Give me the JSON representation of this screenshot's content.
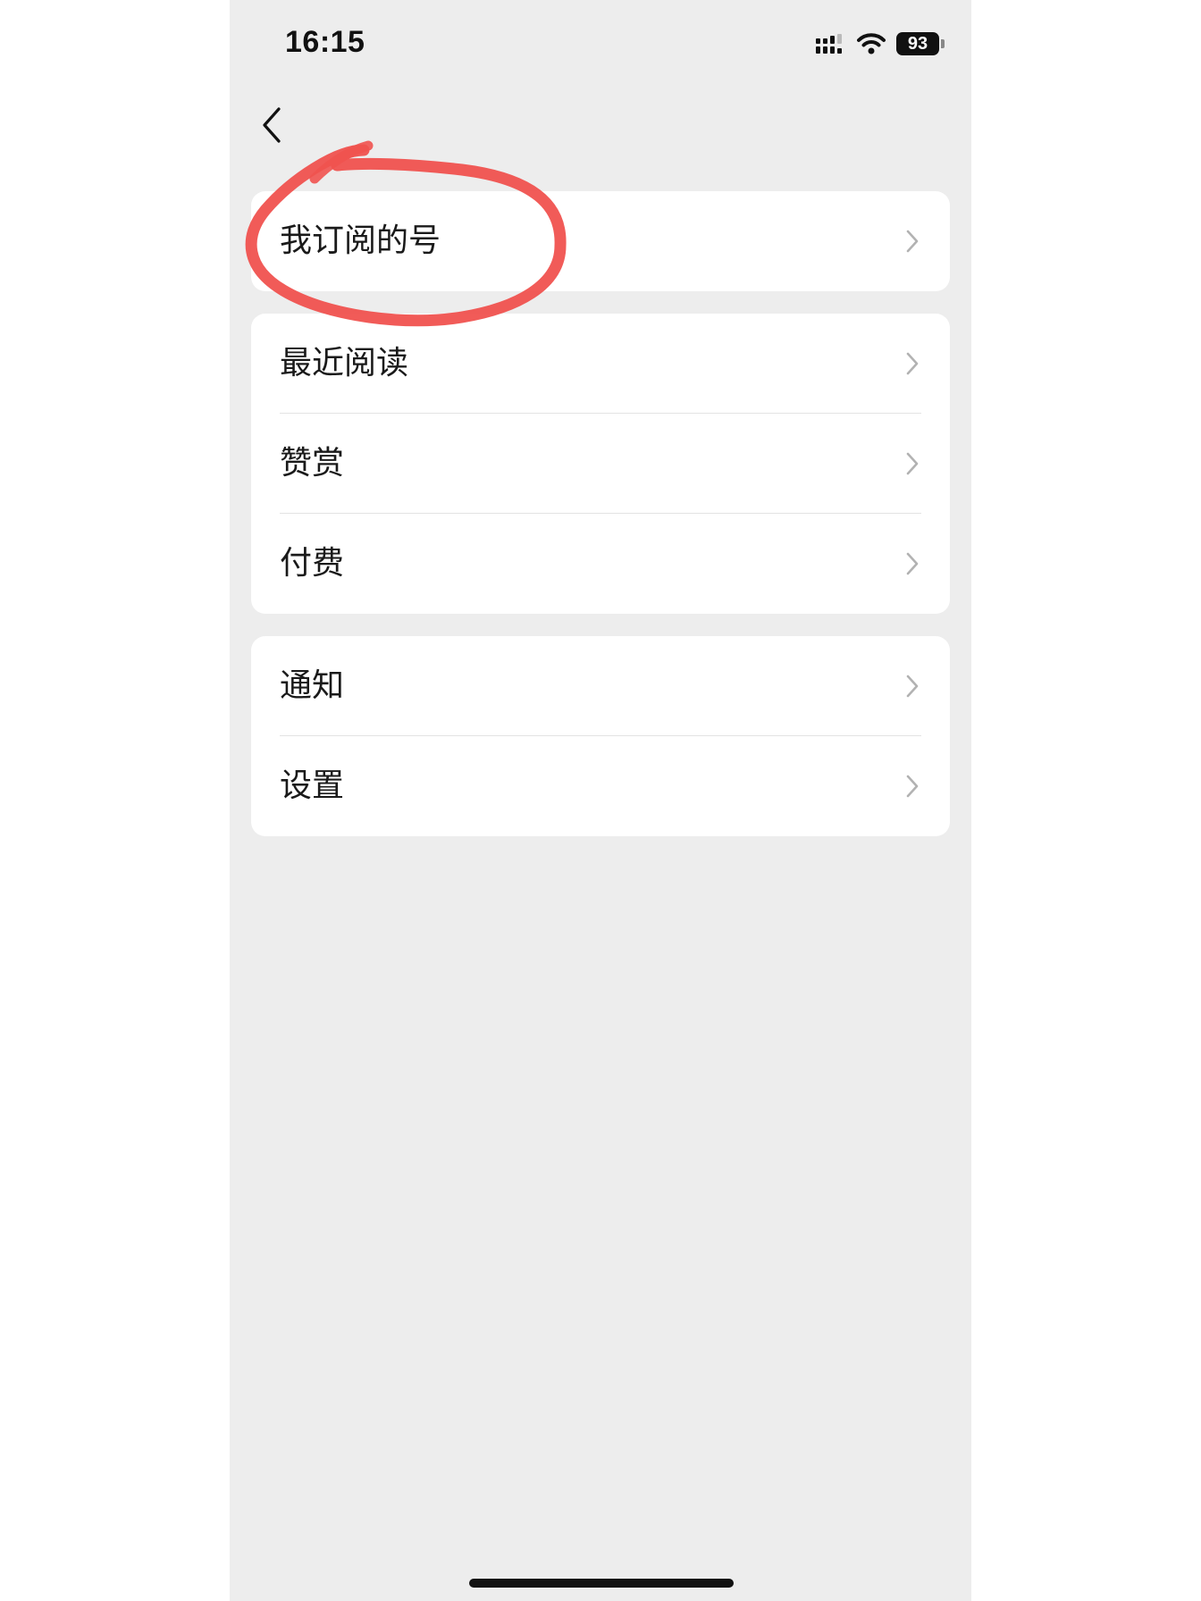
{
  "status_bar": {
    "time": "16:15",
    "battery_level": "93",
    "signal_icon": "cellular-signal-icon",
    "wifi_icon": "wifi-icon"
  },
  "nav": {
    "back_icon": "chevron-left-icon"
  },
  "groups": [
    {
      "items": [
        {
          "label": "我订阅的号"
        }
      ]
    },
    {
      "items": [
        {
          "label": "最近阅读"
        },
        {
          "label": "赞赏"
        },
        {
          "label": "付费"
        }
      ]
    },
    {
      "items": [
        {
          "label": "通知"
        },
        {
          "label": "设置"
        }
      ]
    }
  ],
  "colors": {
    "background": "#ededed",
    "card": "#ffffff",
    "annotation_circle": "#f0524f",
    "chevron": "#b2b2b2"
  }
}
